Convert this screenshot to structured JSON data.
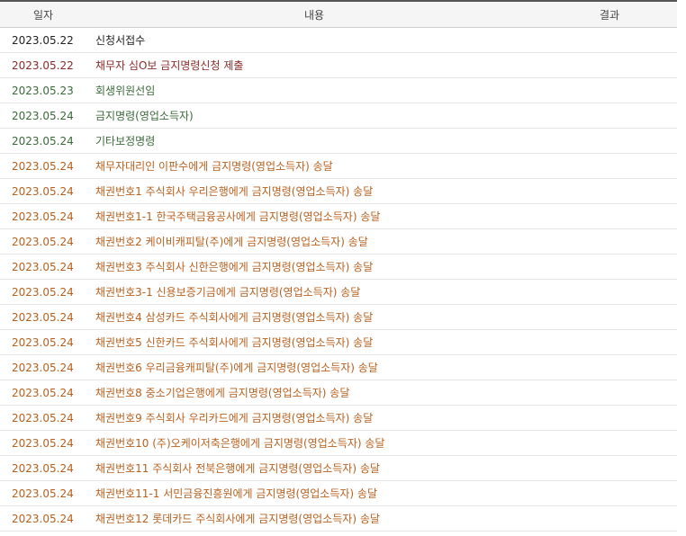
{
  "header": {
    "date": "일자",
    "content": "내용",
    "result": "결과"
  },
  "colors": {
    "black": "#222222",
    "red": "#8a2a2a",
    "green": "#3a6a3a",
    "orange": "#b8601e"
  },
  "rows": [
    {
      "date": "2023.05.22",
      "content": "신청서접수",
      "result": "",
      "color": "black"
    },
    {
      "date": "2023.05.22",
      "content": "채무자 심O보 금지명령신청 제출",
      "result": "",
      "color": "red"
    },
    {
      "date": "2023.05.23",
      "content": "회생위원선임",
      "result": "",
      "color": "green"
    },
    {
      "date": "2023.05.24",
      "content": "금지명령(영업소득자)",
      "result": "",
      "color": "green"
    },
    {
      "date": "2023.05.24",
      "content": "기타보정명령",
      "result": "",
      "color": "green"
    },
    {
      "date": "2023.05.24",
      "content": "채무자대리인 이판수에게 금지명령(영업소득자) 송달",
      "result": "",
      "color": "orange"
    },
    {
      "date": "2023.05.24",
      "content": "채권번호1 주식회사 우리은행에게 금지명령(영업소득자) 송달",
      "result": "",
      "color": "orange"
    },
    {
      "date": "2023.05.24",
      "content": "채권번호1-1 한국주택금융공사에게 금지명령(영업소득자) 송달",
      "result": "",
      "color": "orange"
    },
    {
      "date": "2023.05.24",
      "content": "채권번호2 케이비캐피탈(주)에게 금지명령(영업소득자) 송달",
      "result": "",
      "color": "orange"
    },
    {
      "date": "2023.05.24",
      "content": "채권번호3 주식회사 신한은행에게 금지명령(영업소득자) 송달",
      "result": "",
      "color": "orange"
    },
    {
      "date": "2023.05.24",
      "content": "채권번호3-1 신용보증기금에게 금지명령(영업소득자) 송달",
      "result": "",
      "color": "orange"
    },
    {
      "date": "2023.05.24",
      "content": "채권번호4 삼성카드 주식회사에게 금지명령(영업소득자) 송달",
      "result": "",
      "color": "orange"
    },
    {
      "date": "2023.05.24",
      "content": "채권번호5 신한카드 주식회사에게 금지명령(영업소득자) 송달",
      "result": "",
      "color": "orange"
    },
    {
      "date": "2023.05.24",
      "content": "채권번호6 우리금융캐피탈(주)에게 금지명령(영업소득자) 송달",
      "result": "",
      "color": "orange"
    },
    {
      "date": "2023.05.24",
      "content": "채권번호8 중소기업은행에게 금지명령(영업소득자) 송달",
      "result": "",
      "color": "orange"
    },
    {
      "date": "2023.05.24",
      "content": "채권번호9 주식회사 우리카드에게 금지명령(영업소득자) 송달",
      "result": "",
      "color": "orange"
    },
    {
      "date": "2023.05.24",
      "content": "채권번호10 (주)오케이저축은행에게 금지명령(영업소득자) 송달",
      "result": "",
      "color": "orange"
    },
    {
      "date": "2023.05.24",
      "content": "채권번호11 주식회사 전북은행에게 금지명령(영업소득자) 송달",
      "result": "",
      "color": "orange"
    },
    {
      "date": "2023.05.24",
      "content": "채권번호11-1 서민금융진흥원에게 금지명령(영업소득자) 송달",
      "result": "",
      "color": "orange"
    },
    {
      "date": "2023.05.24",
      "content": "채권번호12 롯데카드 주식회사에게 금지명령(영업소득자) 송달",
      "result": "",
      "color": "orange"
    }
  ]
}
